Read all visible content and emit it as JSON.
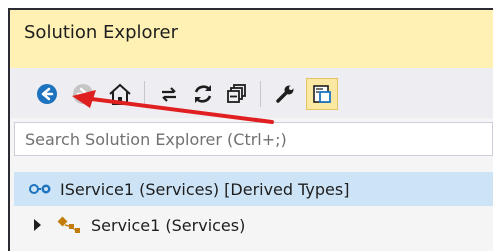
{
  "window": {
    "title": "Solution Explorer"
  },
  "toolbar": {
    "icons": [
      "back-icon",
      "forward-icon",
      "home-icon",
      "sync-icon",
      "refresh-icon",
      "collapse-all-icon",
      "properties-icon",
      "preview-icon"
    ]
  },
  "search": {
    "placeholder": "Search Solution Explorer (Ctrl+;)"
  },
  "tree": {
    "items": [
      {
        "label": "IService1  (Services) [Derived Types]",
        "icon": "interface-icon",
        "selected": true
      },
      {
        "label": "Service1  (Services)",
        "icon": "class-icon",
        "selected": false
      }
    ]
  },
  "colors": {
    "title_bar": "#fff1b3",
    "selection": "#cde4f7",
    "annotation_arrow": "#e02020"
  }
}
